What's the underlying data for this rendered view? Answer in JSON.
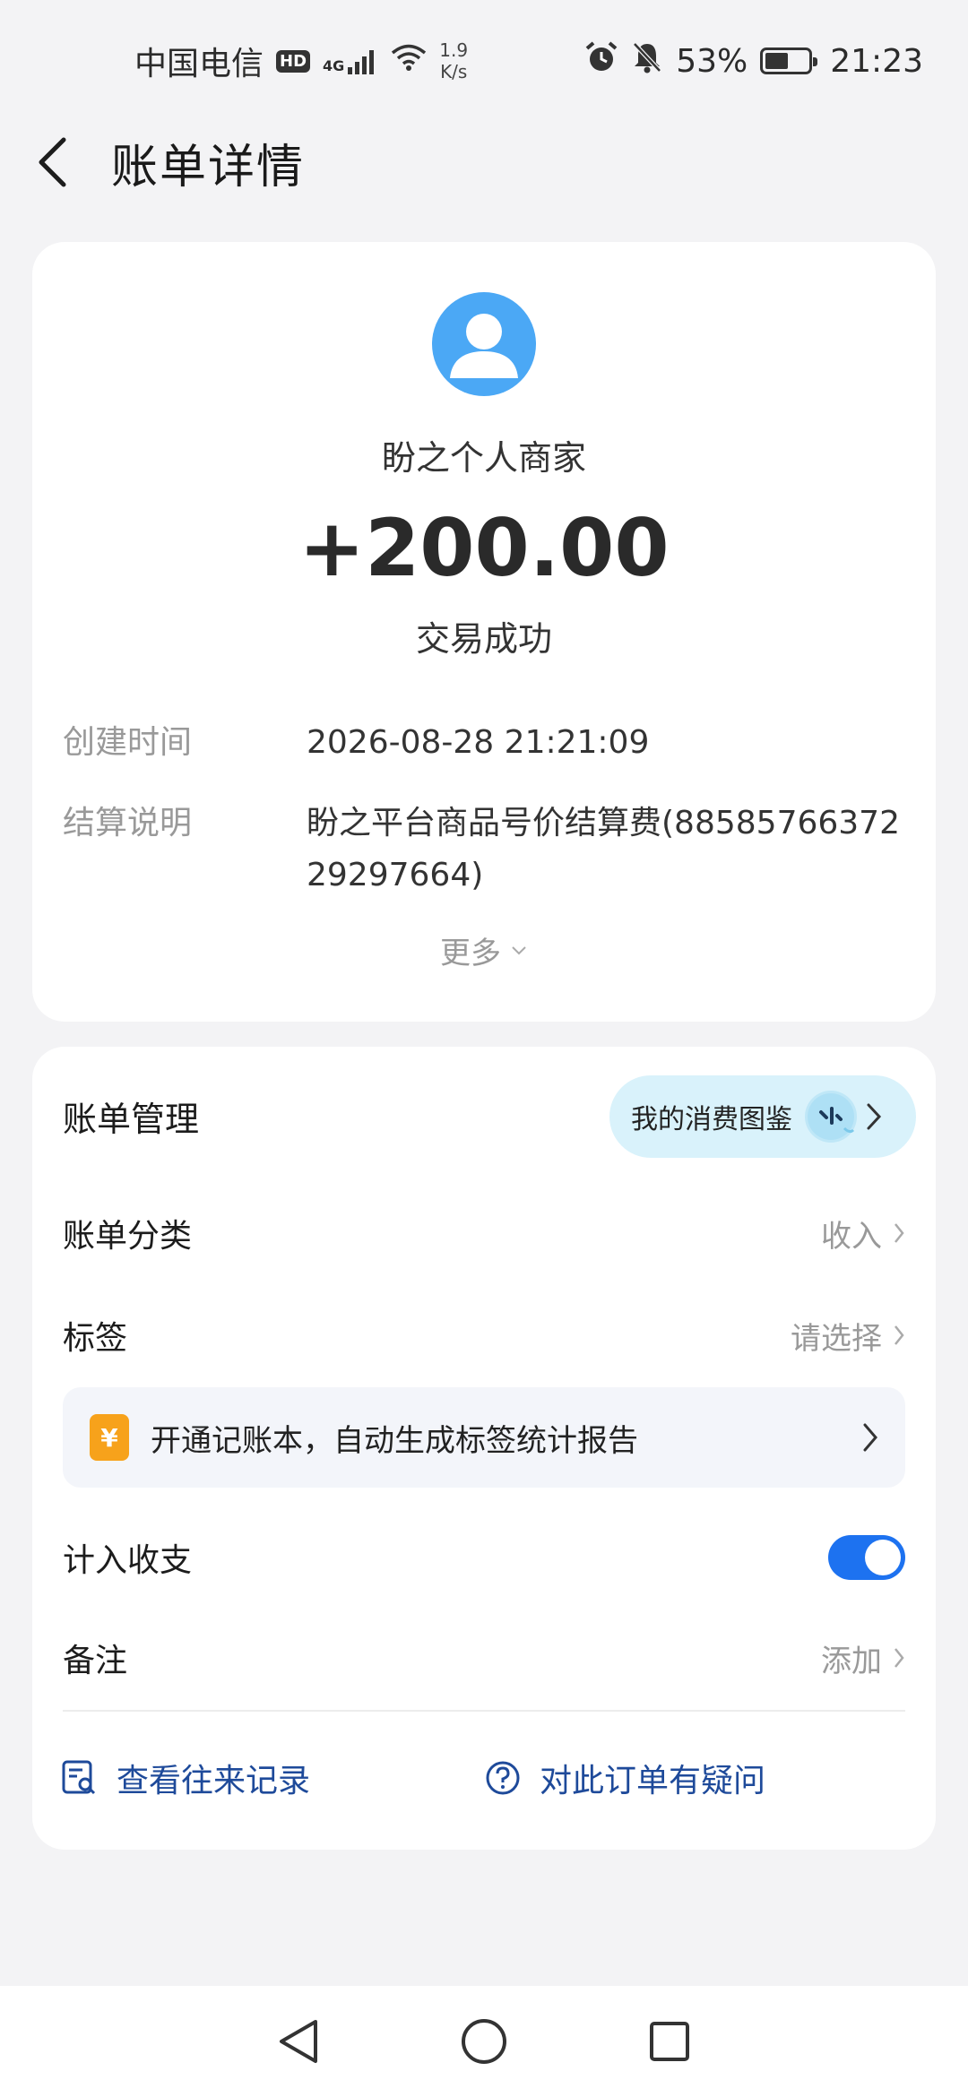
{
  "status_bar": {
    "carrier": "中国电信",
    "hd": "HD",
    "network": "4G",
    "speed_value": "1.9",
    "speed_unit": "K/s",
    "battery": "53%",
    "battery_level": 0.53,
    "time": "21:23"
  },
  "header": {
    "title": "账单详情"
  },
  "bill": {
    "merchant": "盼之个人商家",
    "amount": "+200.00",
    "status": "交易成功",
    "created_label": "创建时间",
    "created_value": "2026-08-28 21:21:09",
    "settle_label": "结算说明",
    "settle_value": "盼之平台商品号价结算费(8858576637229297664)",
    "more": "更多"
  },
  "management": {
    "title": "账单管理",
    "gallery": "我的消费图鉴",
    "category_label": "账单分类",
    "category_value": "收入",
    "tag_label": "标签",
    "tag_value": "请选择",
    "promo_icon": "¥",
    "promo_text": "开通记账本，自动生成标签统计报告",
    "include_label": "计入收支",
    "include_on": true,
    "note_label": "备注",
    "note_value": "添加",
    "history_link": "查看往来记录",
    "question_link": "对此订单有疑问"
  },
  "colors": {
    "accent_blue": "#1d72f0",
    "avatar_blue": "#4ba8f5",
    "link_blue": "#1e4a9a",
    "promo_orange": "#f7a21b"
  }
}
